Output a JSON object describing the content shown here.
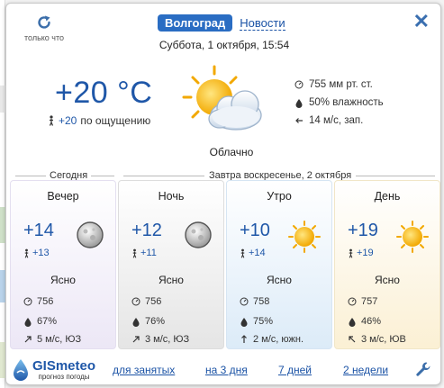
{
  "header": {
    "refresh_label": "только что",
    "city": "Волгоград",
    "news": "Новости",
    "close": "✕",
    "date": "Суббота, 1 октября, 15:54"
  },
  "now": {
    "temp": "+20 °C",
    "feels_value": "+20",
    "feels_label": "по ощущению",
    "condition": "Облачно",
    "icon": "sun-cloud-icon",
    "pressure": "755 мм рт. ст.",
    "humidity": "50% влажность",
    "wind": "14 м/с, зап."
  },
  "sections": {
    "today": "Сегодня",
    "tomorrow": "Завтра воскресенье, 2 октября"
  },
  "cards": [
    {
      "title": "Вечер",
      "temp": "+14",
      "feels": "+13",
      "desc": "Ясно",
      "pressure": "756",
      "humidity": "67%",
      "wind": "5 м/с, ЮЗ",
      "icon": "moon-icon"
    },
    {
      "title": "Ночь",
      "temp": "+12",
      "feels": "+11",
      "desc": "Ясно",
      "pressure": "756",
      "humidity": "76%",
      "wind": "3 м/с, ЮЗ",
      "icon": "moon-icon"
    },
    {
      "title": "Утро",
      "temp": "+10",
      "feels": "+14",
      "desc": "Ясно",
      "pressure": "758",
      "humidity": "75%",
      "wind": "2 м/с, южн.",
      "icon": "sun-icon"
    },
    {
      "title": "День",
      "temp": "+19",
      "feels": "+19",
      "desc": "Ясно",
      "pressure": "757",
      "humidity": "46%",
      "wind": "3 м/с, ЮВ",
      "icon": "sun-icon"
    }
  ],
  "footer": {
    "logo": "GISmeteo",
    "logo_sub": "прогноз погоды",
    "links": [
      "для занятых",
      "на 3 дня",
      "7 дней",
      "2 недели"
    ],
    "settings_icon": "wrench-icon"
  },
  "colors": {
    "accent": "#1f57a8",
    "city_tab": "#2a6dc3",
    "sun": "#f5b800"
  }
}
